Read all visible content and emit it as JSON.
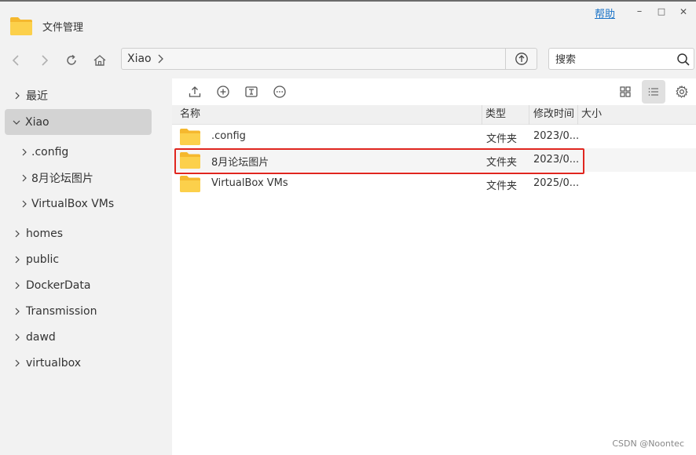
{
  "app": {
    "title": "文件管理",
    "help": "帮助"
  },
  "window_controls": {
    "minimize": "–",
    "maximize": "□",
    "close": "✕"
  },
  "nav": {
    "back": "back-icon",
    "forward": "forward-icon",
    "refresh": "refresh-icon",
    "home": "home-icon",
    "path": [
      "Xiao"
    ],
    "search_placeholder": "搜索"
  },
  "sidebar": {
    "items": [
      {
        "label": "最近",
        "expanded": false,
        "level": 0
      },
      {
        "label": "Xiao",
        "expanded": true,
        "level": 0,
        "active": true
      },
      {
        "label": ".config",
        "expanded": false,
        "level": 1
      },
      {
        "label": "8月论坛图片",
        "expanded": false,
        "level": 1
      },
      {
        "label": "VirtualBox VMs",
        "expanded": false,
        "level": 1
      },
      {
        "label": "homes",
        "expanded": false,
        "level": 0
      },
      {
        "label": "public",
        "expanded": false,
        "level": 0
      },
      {
        "label": "DockerData",
        "expanded": false,
        "level": 0
      },
      {
        "label": "Transmission",
        "expanded": false,
        "level": 0
      },
      {
        "label": "dawd",
        "expanded": false,
        "level": 0
      },
      {
        "label": "virtualbox",
        "expanded": false,
        "level": 0
      }
    ]
  },
  "toolbar": {
    "upload": "upload-icon",
    "new": "add-icon",
    "rename": "rename-icon",
    "more": "more-icon",
    "grid_view": "grid-view-icon",
    "list_view": "list-view-icon",
    "settings": "gear-icon"
  },
  "table": {
    "columns": {
      "name": "名称",
      "type": "类型",
      "mtime": "修改时间",
      "size": "大小"
    },
    "rows": [
      {
        "name": ".config",
        "type": "文件夹",
        "mtime": "2023/0...",
        "size": ""
      },
      {
        "name": "8月论坛图片",
        "type": "文件夹",
        "mtime": "2023/0...",
        "size": ""
      },
      {
        "name": "VirtualBox VMs",
        "type": "文件夹",
        "mtime": "2025/0...",
        "size": ""
      }
    ]
  },
  "colors": {
    "folder": "#f9c63e",
    "accent": "#1a73c7",
    "highlight_border": "#e0261f"
  },
  "watermark": "CSDN @Noontec"
}
